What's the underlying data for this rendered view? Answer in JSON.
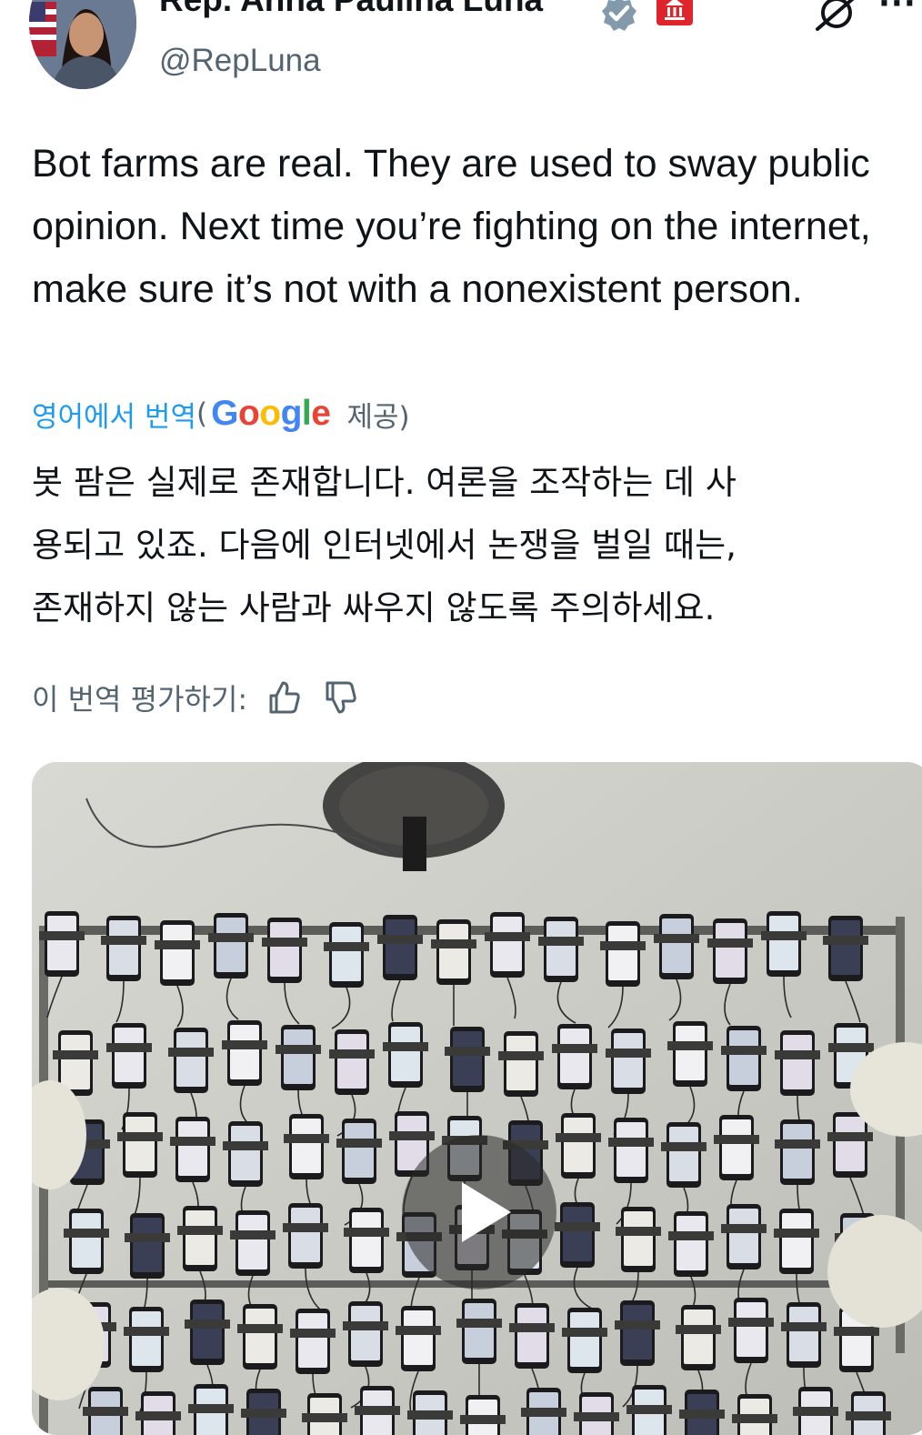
{
  "author": {
    "display_name": "Rep. Anna Paulina Luna",
    "handle": "@RepLuna",
    "avatar_icon": "profile-photo",
    "badges": [
      "verified-badge-icon",
      "government-building-icon"
    ]
  },
  "header_actions": [
    "grok-icon",
    "more-options-icon"
  ],
  "tweet": {
    "text": "Bot farms are real. They are used to sway public opinion. Next time you’re fighting on the internet, make sure it’s not with a nonexistent person."
  },
  "translation": {
    "label": "영어에서 번역",
    "open_paren": "(",
    "provider": "Google",
    "provided": "제공)",
    "lines": [
      "봇 팜은 실제로 존재합니다. 여론을 조작하는 데 사",
      "용되고 있죠. 다음에 인터넷에서 논쟁을 벌일 때는,",
      "존재하지 않는 사람과 싸우지 않도록 주의하세요."
    ],
    "rate_label": "이 번역 평가하기:"
  },
  "media": {
    "type": "video",
    "subject": "phone-farm-rack",
    "play_icon": "play-icon"
  },
  "colors": {
    "link_blue": "#1d9bf0",
    "secondary_text": "#536471",
    "verified_gray": "#829aab",
    "gov_red": "#e0242b"
  }
}
